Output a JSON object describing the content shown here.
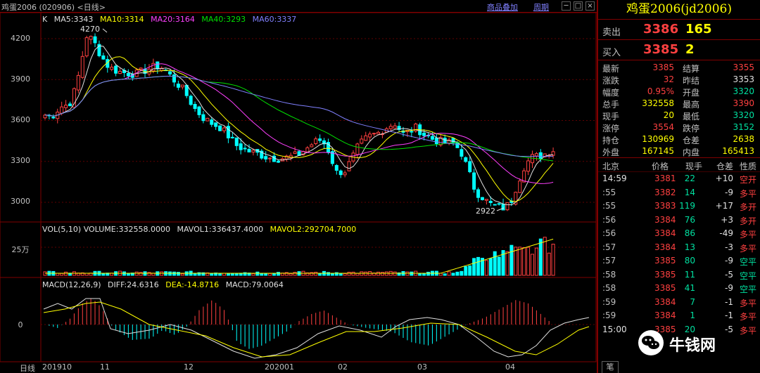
{
  "window": {
    "title": "鸡蛋2006 (020906) <日线>",
    "overlay_link": "商品叠加",
    "period_link": "周期"
  },
  "price_panel": {
    "legend": {
      "k": "K",
      "ma5": "MA5:3343",
      "ma10": "MA10:3314",
      "ma20": "MA20:3164",
      "ma40": "MA40:3293",
      "ma60": "MA60:3337"
    },
    "y_ticks": [
      "4200",
      "3900",
      "3600",
      "3300",
      "3000"
    ],
    "high_label": "4270",
    "low_label": "2922"
  },
  "volume_panel": {
    "legend": {
      "main": "VOL(5,10) VOLUME:332558.0000",
      "mavol1": "MAVOL1:336437.4000",
      "mavol2": "MAVOL2:292704.7000"
    },
    "y_tick": "25万"
  },
  "macd_panel": {
    "legend": {
      "main": "MACD(12,26,9)",
      "diff": "DIFF:24.6316",
      "dea": "DEA:-14.8716",
      "macd": "MACD:79.0064"
    },
    "y_tick": "0"
  },
  "x_axis": {
    "period": "日线",
    "labels": [
      "201910",
      "11",
      "12",
      "202001",
      "02",
      "03",
      "04"
    ]
  },
  "chart_data": {
    "type": "candlestick",
    "price_ylim": [
      2900,
      4300
    ],
    "high": 4270,
    "low": 2922,
    "last": 3385
  },
  "quote": {
    "title": "鸡蛋2006(jd2006)",
    "sell": {
      "label": "卖出",
      "price": "3386",
      "qty": "165"
    },
    "buy": {
      "label": "买入",
      "price": "3385",
      "qty": "2"
    },
    "stats": [
      [
        "最新",
        "3385",
        "结算",
        "3355"
      ],
      [
        "涨跌",
        "32",
        "昨结",
        "3353"
      ],
      [
        "幅度",
        "0.95%",
        "开盘",
        "3320"
      ],
      [
        "总手",
        "332558",
        "最高",
        "3390"
      ],
      [
        "现手",
        "20",
        "最低",
        "3320"
      ],
      [
        "涨停",
        "3554",
        "跌停",
        "3152"
      ],
      [
        "持仓",
        "130969",
        "仓差",
        "2638"
      ],
      [
        "外盘",
        "167145",
        "内盘",
        "165413"
      ]
    ],
    "tick_header": [
      "北京",
      "价格",
      "现手",
      "仓差",
      "性质"
    ],
    "ticks": [
      [
        "14:59",
        "3381",
        "22",
        "+10",
        "空开"
      ],
      [
        ":55",
        "3382",
        "14",
        "-9",
        "多平"
      ],
      [
        ":55",
        "3383",
        "119",
        "+17",
        "多开"
      ],
      [
        ":56",
        "3384",
        "76",
        "+3",
        "多开"
      ],
      [
        ":56",
        "3384",
        "86",
        "-49",
        "多平"
      ],
      [
        ":57",
        "3384",
        "13",
        "-3",
        "多平"
      ],
      [
        ":57",
        "3385",
        "80",
        "-9",
        "空平"
      ],
      [
        ":58",
        "3385",
        "11",
        "-5",
        "空平"
      ],
      [
        ":58",
        "3385",
        "41",
        "-9",
        "空平"
      ],
      [
        ":59",
        "3384",
        "7",
        "-1",
        "多平"
      ],
      [
        ":59",
        "3384",
        "1",
        "-1",
        "多平"
      ],
      [
        "15:00",
        "3385",
        "20",
        "-5",
        "多平"
      ]
    ],
    "tab": "笔"
  },
  "watermark": "牛钱网"
}
